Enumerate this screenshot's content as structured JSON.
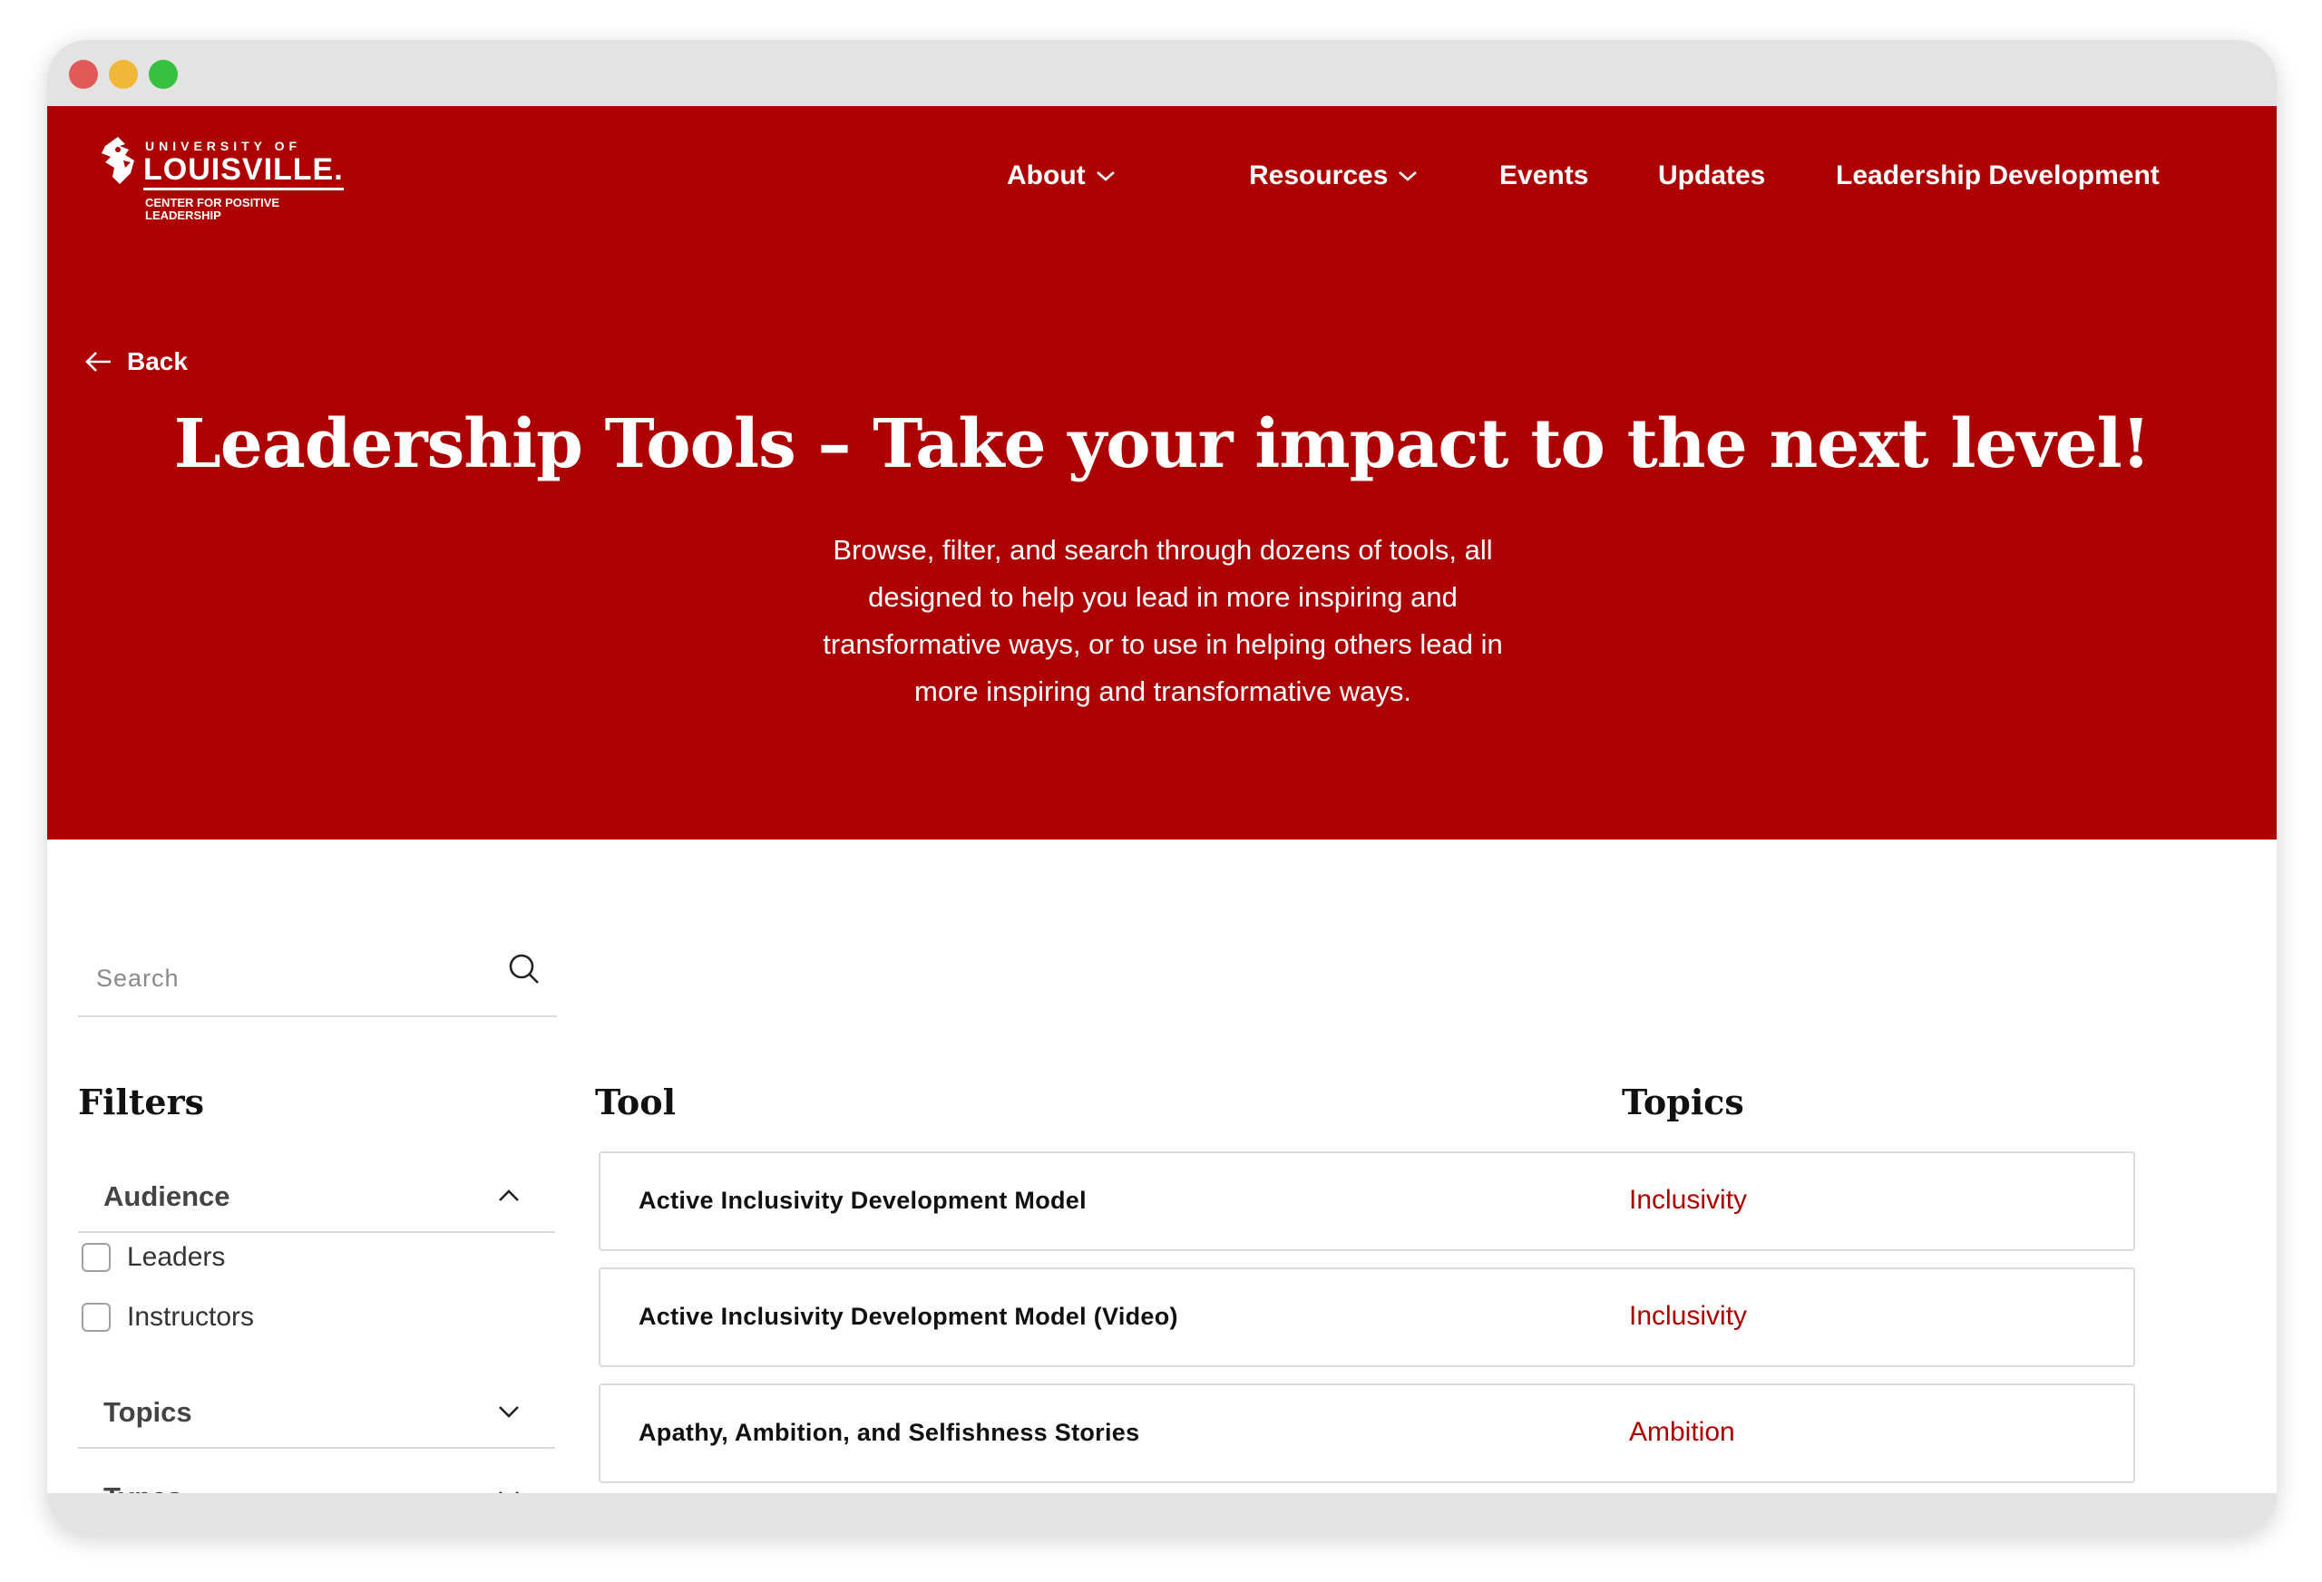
{
  "logo": {
    "university": "UNIVERSITY OF",
    "name": "LOUISVILLE.",
    "subtitle_line1": "CENTER FOR POSITIVE",
    "subtitle_line2": "LEADERSHIP"
  },
  "nav": {
    "items": [
      {
        "label": "About",
        "has_dropdown": true
      },
      {
        "label": "Resources",
        "has_dropdown": true
      },
      {
        "label": "Events",
        "has_dropdown": false
      },
      {
        "label": "Updates",
        "has_dropdown": false
      },
      {
        "label": "Leadership Development",
        "has_dropdown": false
      }
    ]
  },
  "hero": {
    "back_label": "Back",
    "title": "Leadership Tools – Take your impact to the next level!",
    "description_lines": [
      "Browse, filter, and search through dozens of tools, all",
      "designed to help you lead in more inspiring and",
      "transformative ways, or to use in helping others lead in",
      "more inspiring and transformative ways."
    ]
  },
  "search": {
    "placeholder": "Search",
    "value": ""
  },
  "filters": {
    "title": "Filters",
    "groups": [
      {
        "label": "Audience",
        "expanded": true,
        "options": [
          "Leaders",
          "Instructors"
        ]
      },
      {
        "label": "Topics",
        "expanded": false,
        "options": []
      },
      {
        "label": "Types",
        "expanded": false,
        "options": []
      }
    ]
  },
  "table": {
    "headers": {
      "tool": "Tool",
      "topics": "Topics"
    },
    "rows": [
      {
        "tool": "Active Inclusivity Development Model",
        "topic": "Inclusivity"
      },
      {
        "tool": "Active Inclusivity Development Model (Video)",
        "topic": "Inclusivity"
      },
      {
        "tool": "Apathy, Ambition, and Selfishness Stories",
        "topic": "Ambition"
      }
    ]
  },
  "colors": {
    "brand_red": "#ad0000",
    "topic_text": "#ad0000",
    "chrome_gray": "#e3e3e3"
  }
}
